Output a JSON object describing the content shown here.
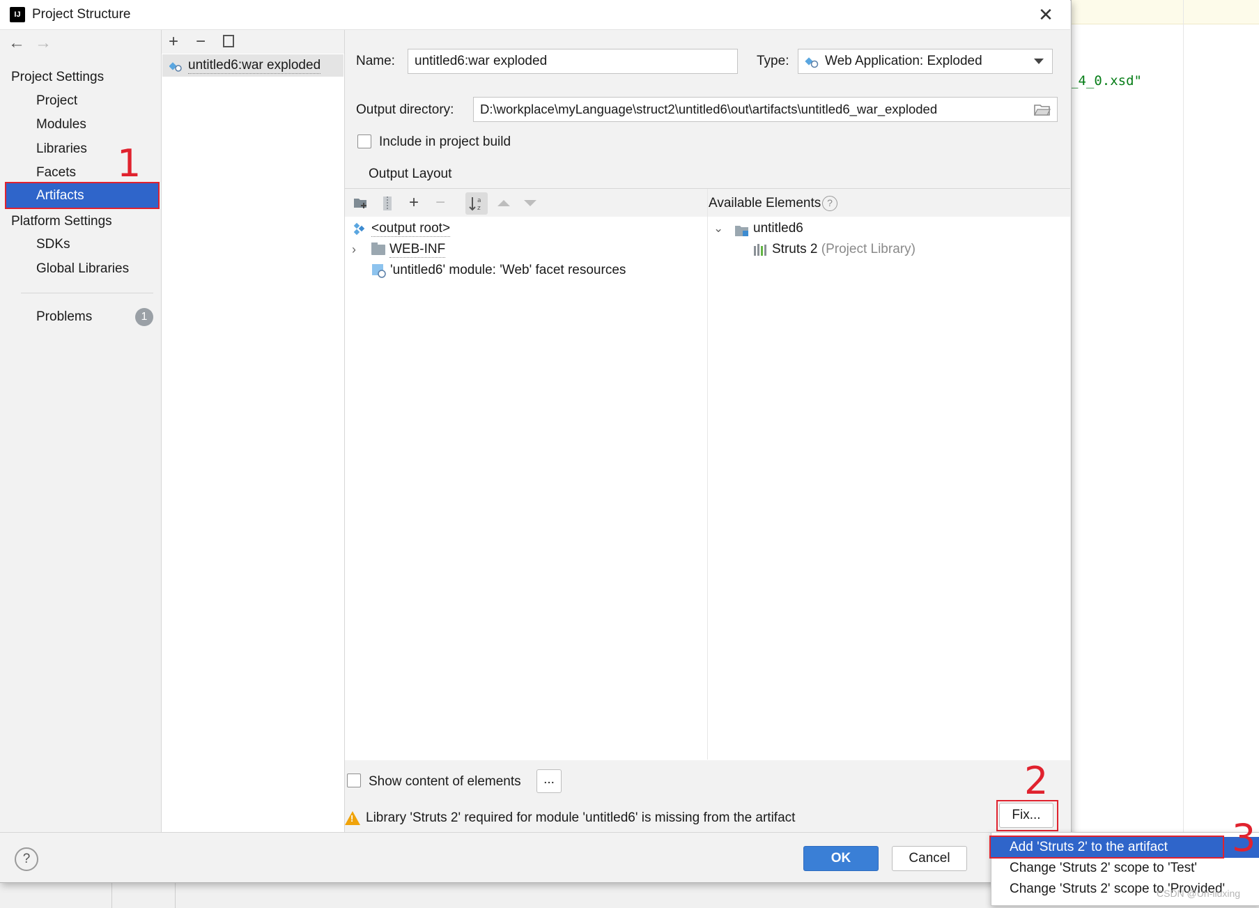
{
  "window": {
    "title": "Project Structure"
  },
  "background": {
    "code_snippet": "_4_0.xsd\""
  },
  "nav": {
    "project_settings_header": "Project Settings",
    "items_project": [
      "Project",
      "Modules",
      "Libraries",
      "Facets",
      "Artifacts"
    ],
    "platform_settings_header": "Platform Settings",
    "items_platform": [
      "SDKs",
      "Global Libraries"
    ],
    "problems_label": "Problems",
    "problems_count": "1",
    "selected": "Artifacts"
  },
  "artifacts": {
    "items": [
      "untitled6:war exploded"
    ]
  },
  "form": {
    "name_label": "Name:",
    "name_value": "untitled6:war exploded",
    "type_label": "Type:",
    "type_value": "Web Application: Exploded",
    "output_dir_label": "Output directory:",
    "output_dir_value": "D:\\workplace\\myLanguage\\struct2\\untitled6\\out\\artifacts\\untitled6_war_exploded",
    "include_build_label": "Include in project build",
    "output_layout_tab": "Output Layout"
  },
  "layout_tree": [
    "<output root>",
    "WEB-INF",
    "'untitled6' module: 'Web' facet resources"
  ],
  "available": {
    "header": "Available Elements",
    "module": "untitled6",
    "library_name": "Struts 2",
    "library_suffix": "(Project Library)"
  },
  "show_content_label": "Show content of elements",
  "ellipsis_button": "...",
  "warning_text": "Library 'Struts 2' required for module 'untitled6' is missing from the artifact",
  "fix_button": "Fix...",
  "buttons": {
    "ok": "OK",
    "cancel": "Cancel",
    "help": "?"
  },
  "popup_menu": [
    "Add 'Struts 2' to the artifact",
    "Change 'Struts 2' scope to 'Test'",
    "Change 'Struts 2' scope to 'Provided'"
  ],
  "annotations": [
    "1",
    "2",
    "3"
  ],
  "watermark": "CSDN @Uh-liuxing",
  "colors": {
    "selection": "#2f65ca",
    "annotation_red": "#e0222e",
    "primary_button": "#3a7fd6",
    "warning": "#f0a30a"
  }
}
